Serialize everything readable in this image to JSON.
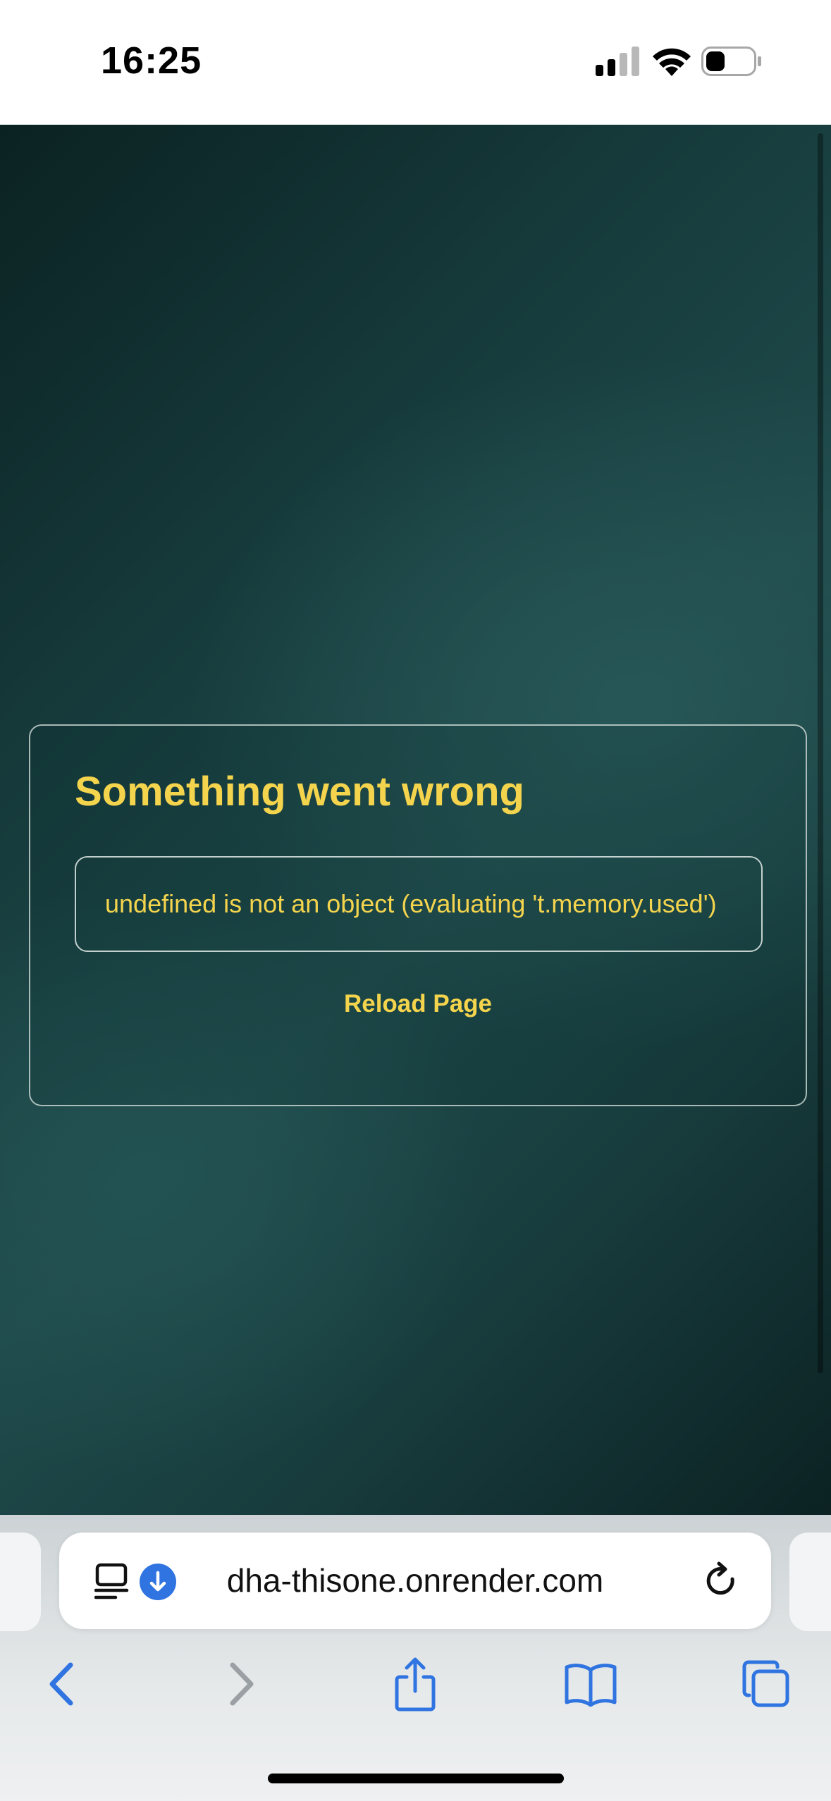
{
  "status_bar": {
    "time": "16:25",
    "icons": [
      "cellular-signal-icon",
      "wifi-icon",
      "battery-icon"
    ]
  },
  "error": {
    "title": "Something went wrong",
    "message": "undefined is not an object (evaluating 't.memory.used')",
    "reload_label": "Reload Page"
  },
  "browser": {
    "url": "dha-thisone.onrender.com",
    "address_icons": [
      "reader-mode-icon",
      "download-icon"
    ],
    "toolbar_icons": [
      "back-icon",
      "forward-icon",
      "share-icon",
      "bookmarks-icon",
      "tabs-icon"
    ]
  },
  "colors": {
    "accent": "#f4d44d",
    "safari_blue": "#2f74e0",
    "background_dark": "#0b2222",
    "background_mid": "#1f4a4b"
  }
}
